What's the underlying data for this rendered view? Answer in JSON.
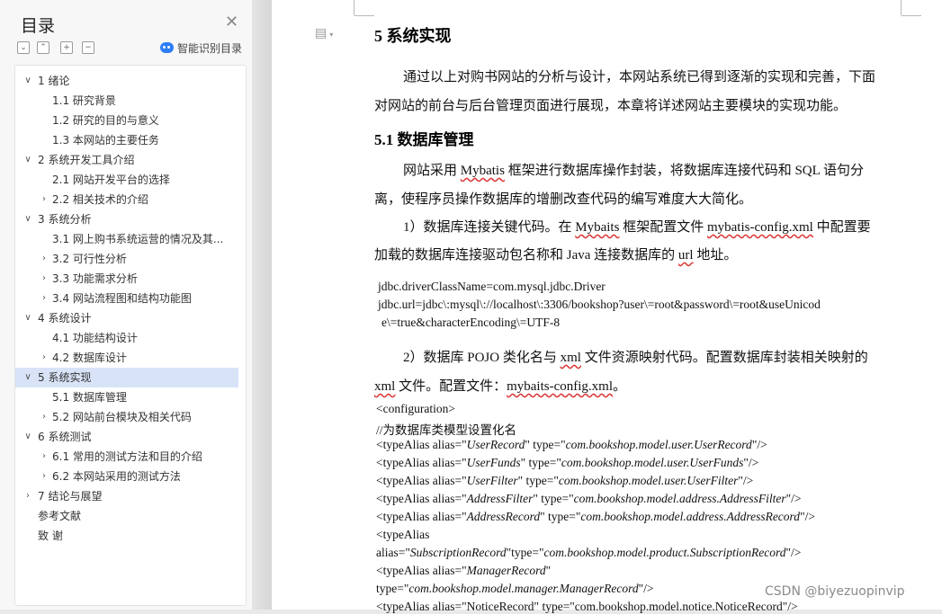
{
  "toc": {
    "title": "目录",
    "smart_label": "智能识别目录",
    "items": [
      {
        "chev": "∨",
        "label": "1  绪论",
        "level": 1
      },
      {
        "chev": "",
        "label": "1.1 研究背景",
        "level": 2
      },
      {
        "chev": "",
        "label": "1.2 研究的目的与意义",
        "level": 2
      },
      {
        "chev": "",
        "label": "1.3 本网站的主要任务",
        "level": 2
      },
      {
        "chev": "∨",
        "label": "2  系统开发工具介绍",
        "level": 1
      },
      {
        "chev": "",
        "label": "2.1 网站开发平台的选择",
        "level": 2
      },
      {
        "chev": "›",
        "label": "2.2 相关技术的介绍",
        "level": 2
      },
      {
        "chev": "∨",
        "label": "3  系统分析",
        "level": 1
      },
      {
        "chev": "",
        "label": "3.1  网上购书系统运营的情况及其...",
        "level": 2
      },
      {
        "chev": "›",
        "label": "3.2  可行性分析",
        "level": 2
      },
      {
        "chev": "›",
        "label": "3.3  功能需求分析",
        "level": 2
      },
      {
        "chev": "›",
        "label": "3.4 网站流程图和结构功能图",
        "level": 2
      },
      {
        "chev": "∨",
        "label": "4  系统设计",
        "level": 1
      },
      {
        "chev": "",
        "label": "4.1 功能结构设计",
        "level": 2
      },
      {
        "chev": "›",
        "label": "4.2  数据库设计",
        "level": 2
      },
      {
        "chev": "∨",
        "label": "5  系统实现",
        "level": 1,
        "active": true
      },
      {
        "chev": "",
        "label": "5.1  数据库管理",
        "level": 2
      },
      {
        "chev": "›",
        "label": "5.2  网站前台模块及相关代码",
        "level": 2
      },
      {
        "chev": "∨",
        "label": "6  系统测试",
        "level": 1
      },
      {
        "chev": "›",
        "label": "6.1 常用的测试方法和目的介绍",
        "level": 2
      },
      {
        "chev": "›",
        "label": "6.2 本网站采用的测试方法",
        "level": 2
      },
      {
        "chev": "›",
        "label": "7  结论与展望",
        "level": 1
      },
      {
        "chev": "",
        "label": "参考文献",
        "level": 1
      },
      {
        "chev": "",
        "label": "致    谢",
        "level": 1
      }
    ]
  },
  "doc": {
    "h1": "5  系统实现",
    "p1_line1": "通过以上对购书网站的分析与设计，本网站系统已得到逐渐的实现和完善，下面",
    "p1_line2": "对网站的前台与后台管理页面进行展现，本章将详述网站主要模块的实现功能。",
    "h2": "5.1  数据库管理",
    "p2_a": "网站采用 ",
    "p2_b": "Mybatis",
    "p2_c": " 框架进行数据库操作封装，将数据库连接代码和 SQL 语句分",
    "p2_line2": "离，使程序员操作数据库的增删改查代码的编写难度大大简化。",
    "p3_a": "1）数据库连接关键代码。在 ",
    "p3_b": "Mybaits",
    "p3_c": " 框架配置文件 ",
    "p3_d": "mybatis-config.xml",
    "p3_e": " 中配置要",
    "p3_line2_a": "加载的数据库连接驱动包名称和 Java 连接数据库的 ",
    "p3_line2_b": "url",
    "p3_line2_c": " 地址。",
    "code1": "jdbc.driverClassName=com.mysql.jdbc.Driver",
    "code2": "jdbc.url=jdbc\\:mysql\\://localhost\\:3306/bookshop?user\\=root&password\\=root&useUnicod",
    "code3": "e\\=true&characterEncoding\\=UTF-8",
    "p4_a": "2）数据库 POJO 类化名与 ",
    "p4_b": "xml",
    "p4_c": " 文件资源映射代码。配置数据库封装相关映射的",
    "p4_line2_a": "xml",
    "p4_line2_b": " 文件。配置文件：",
    "p4_line2_c": "mybaits-config.xml",
    "p4_line2_d": "。",
    "xml0": "<configuration>",
    "xml1": "//为数据库类模型设置化名",
    "xml_lines": [
      {
        "pre": "<typeAlias alias=\"",
        "a": "UserRecord",
        "mid": "\" type=\"",
        "b": "com.bookshop.model.user.UserRecord",
        "post": "\"/>"
      },
      {
        "pre": "<typeAlias alias=\"",
        "a": "UserFunds",
        "mid": "\" type=\"",
        "b": "com.bookshop.model.user.UserFunds",
        "post": "\"/>"
      },
      {
        "pre": "<typeAlias alias=\"",
        "a": "UserFilter",
        "mid": "\" type=\"",
        "b": "com.bookshop.model.user.UserFilter",
        "post": "\"/>"
      },
      {
        "pre": "<typeAlias alias=\"",
        "a": "AddressFilter",
        "mid": "\" type=\"",
        "b": "com.bookshop.model.address.AddressFilter",
        "post": "\"/>"
      },
      {
        "pre": "<typeAlias alias=\"",
        "a": "AddressRecord",
        "mid": "\" type=\"",
        "b": "com.bookshop.model.address.AddressRecord",
        "post": "\"/>"
      }
    ],
    "xml7": "<typeAlias",
    "xml8_pre": "alias=\"",
    "xml8_a": "SubscriptionRecord",
    "xml8_mid": "\"type=\"",
    "xml8_b": "com.bookshop.model.product.SubscriptionRecord",
    "xml8_post": "\"/>",
    "xml9_pre": "<typeAlias alias=\"",
    "xml9_a": "ManagerRecord",
    "xml9_post": "\"",
    "xml10_pre": "type=\"",
    "xml10_b": "com.bookshop.model.manager.ManagerRecord",
    "xml10_post": "\"/>",
    "xml11": "<typeAlias alias=\"NoticeRecord\" type=\"com.bookshop.model.notice.NoticeRecord\"/>"
  },
  "watermark": "CSDN @biyezuopinvip"
}
